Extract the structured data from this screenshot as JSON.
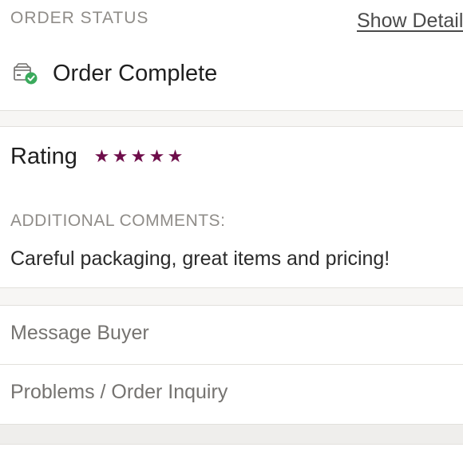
{
  "order_status": {
    "section_title": "ORDER STATUS",
    "show_details_label": "Show Details",
    "status_text": "Order Complete",
    "status_icon": "box-check-icon",
    "accent_color": "#3aaa5c"
  },
  "rating": {
    "label": "Rating",
    "stars": 5,
    "max_stars": 5,
    "star_color": "#6e0d4a",
    "star_glyphs": [
      "★",
      "★",
      "★",
      "★",
      "★"
    ],
    "comments_label": "ADDITIONAL COMMENTS:",
    "comments_text": "Careful packaging, great items and pricing!"
  },
  "actions": {
    "message_buyer": "Message Buyer",
    "problems_inquiry": "Problems / Order Inquiry"
  }
}
